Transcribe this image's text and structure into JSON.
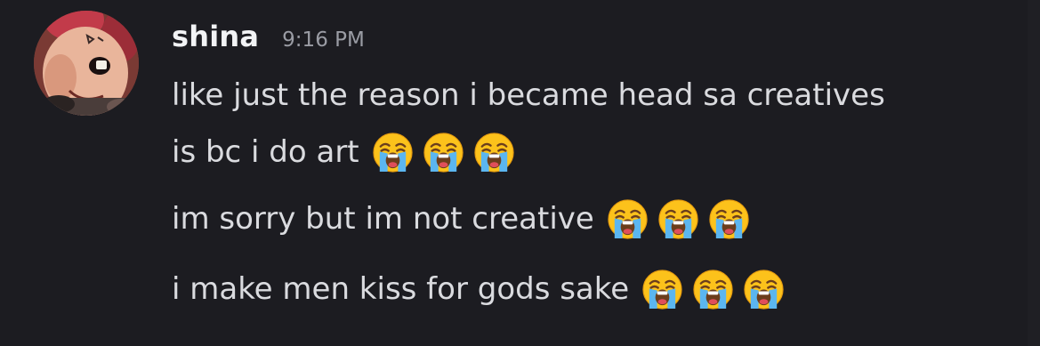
{
  "message": {
    "author": "shina",
    "timestamp": "9:16 PM",
    "avatar_icon": "clay-figure-avatar",
    "lines": [
      {
        "text": "like just the reason i became head sa creatives",
        "emojis": []
      },
      {
        "text": "is bc i do art",
        "emojis": [
          "loudly-crying-face",
          "loudly-crying-face",
          "loudly-crying-face"
        ]
      },
      {
        "text": "im sorry but im not creative",
        "emojis": [
          "loudly-crying-face",
          "loudly-crying-face",
          "loudly-crying-face"
        ]
      },
      {
        "text": "i make men kiss for gods sake",
        "emojis": [
          "loudly-crying-face",
          "loudly-crying-face",
          "loudly-crying-face"
        ]
      }
    ]
  },
  "colors": {
    "background": "#1c1c21",
    "username": "#f2f3f5",
    "timestamp": "#9a9ca4",
    "message_text": "#dadbdf"
  }
}
